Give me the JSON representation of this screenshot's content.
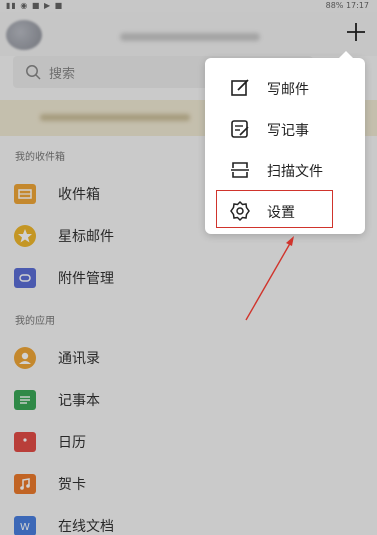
{
  "colors": {
    "inbox": "#f0a637",
    "star": "#f0b82c",
    "attachment": "#5c6ed6",
    "contacts": "#f0a637",
    "notes": "#3aa857",
    "calendar": "#e24c46",
    "cards": "#ec7a2c",
    "docs": "#4a7fe0",
    "highlight": "#d0342c"
  },
  "search": {
    "placeholder": "搜索"
  },
  "sections": {
    "favorites": "我的收件箱",
    "apps": "我的应用"
  },
  "favorites": [
    {
      "label": "收件箱",
      "icon": "inbox-icon"
    },
    {
      "label": "星标邮件",
      "icon": "star-icon"
    },
    {
      "label": "附件管理",
      "icon": "attachment-icon"
    }
  ],
  "apps": [
    {
      "label": "通讯录",
      "icon": "contacts-icon"
    },
    {
      "label": "记事本",
      "icon": "notes-icon"
    },
    {
      "label": "日历",
      "icon": "calendar-icon"
    },
    {
      "label": "贺卡",
      "icon": "card-icon"
    },
    {
      "label": "在线文档",
      "icon": "docs-icon"
    }
  ],
  "menu": {
    "items": [
      {
        "label": "写邮件",
        "icon": "compose-icon"
      },
      {
        "label": "写记事",
        "icon": "note-edit-icon"
      },
      {
        "label": "扫描文件",
        "icon": "scan-icon"
      },
      {
        "label": "设置",
        "icon": "gear-icon"
      }
    ]
  },
  "statusbar": {
    "battery": "88%",
    "time": "17:17"
  }
}
